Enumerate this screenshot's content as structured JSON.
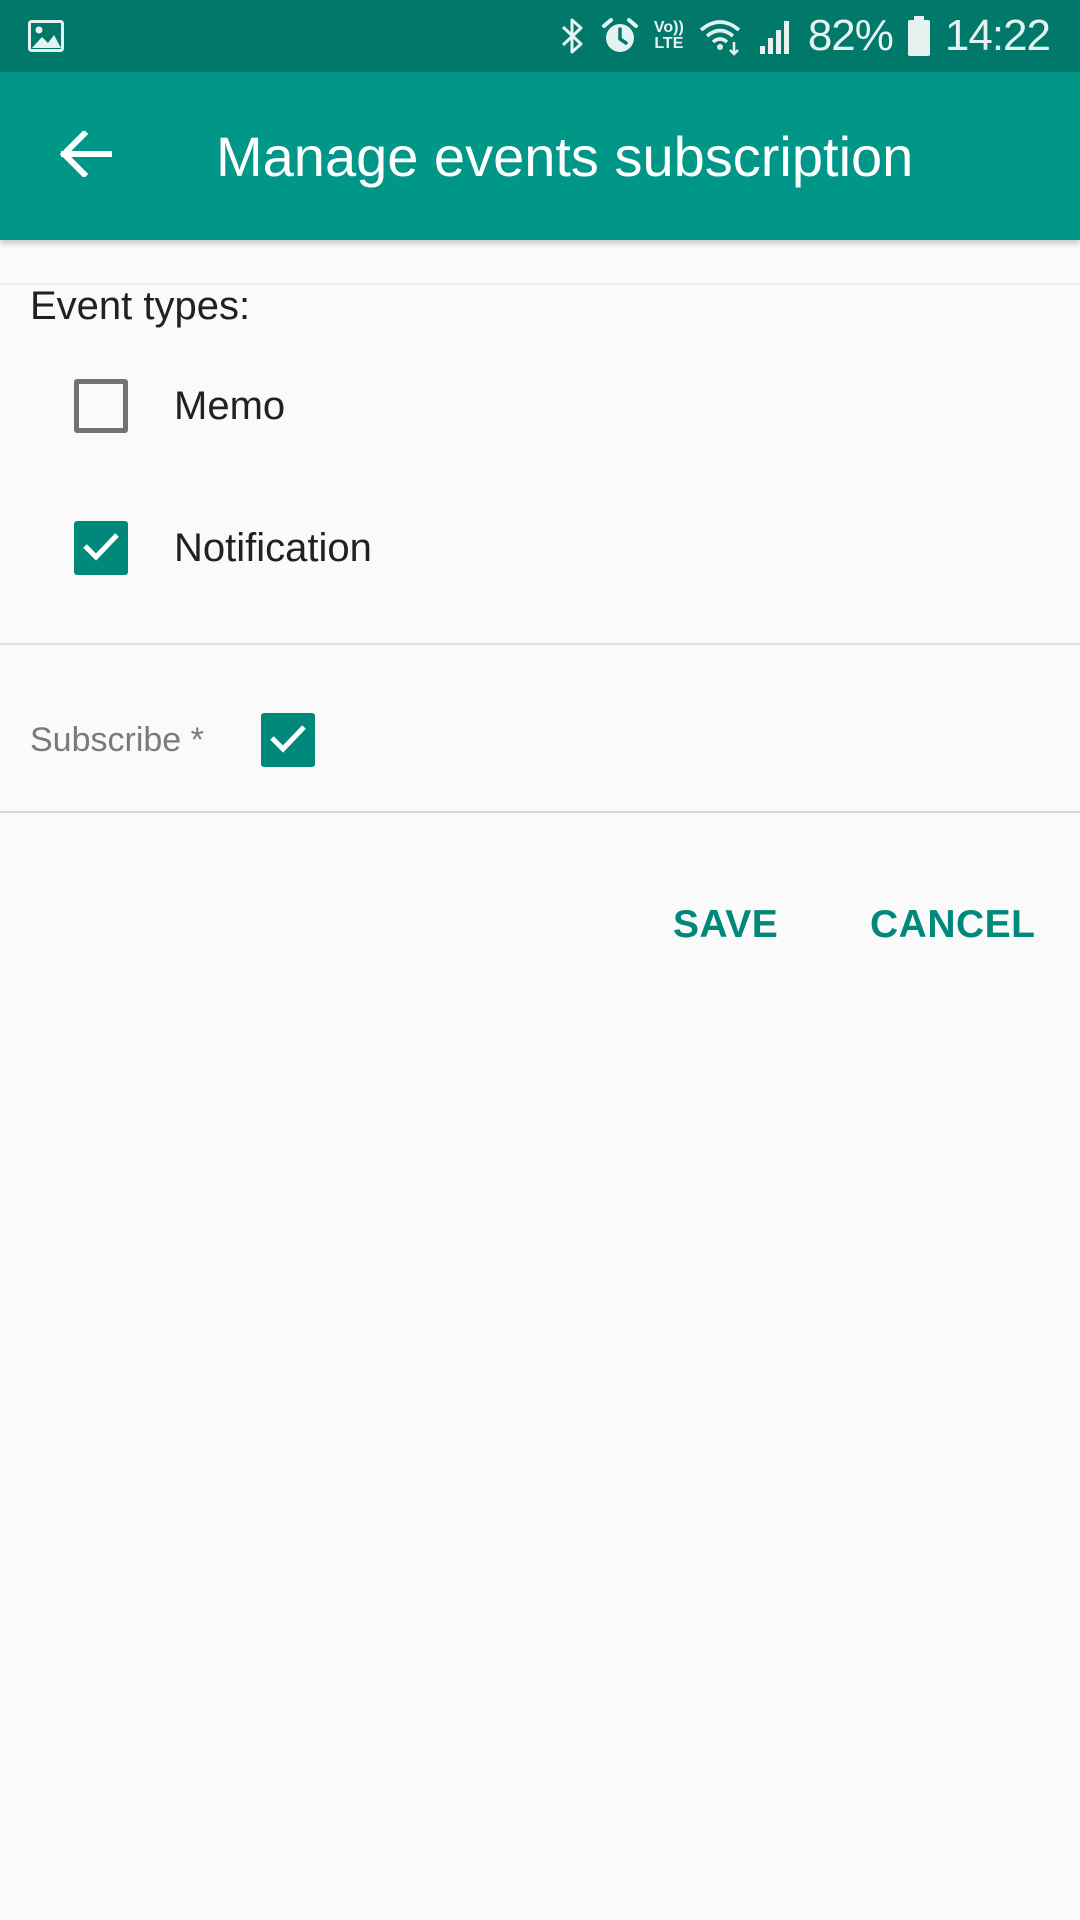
{
  "status_bar": {
    "left_icon": "image-icon",
    "icons": [
      "bluetooth-icon",
      "alarm-icon",
      "volte-icon",
      "wifi-icon",
      "signal-icon",
      "battery-icon"
    ],
    "volte_top": "Vo))",
    "volte_bottom": "LTE",
    "battery": "82%",
    "time": "14:22"
  },
  "app_bar": {
    "title": "Manage events subscription",
    "back_icon": "arrow-back-icon",
    "background": "#009688"
  },
  "form": {
    "event_types_label": "Event types:",
    "event_types": [
      {
        "label": "Memo",
        "checked": false
      },
      {
        "label": "Notification",
        "checked": true
      }
    ],
    "subscribe_label": "Subscribe *",
    "subscribe_checked": true
  },
  "actions": {
    "save_label": "SAVE",
    "cancel_label": "CANCEL"
  },
  "colors": {
    "status_bar": "#00796b",
    "accent": "#00897b",
    "background": "#fafafa"
  }
}
